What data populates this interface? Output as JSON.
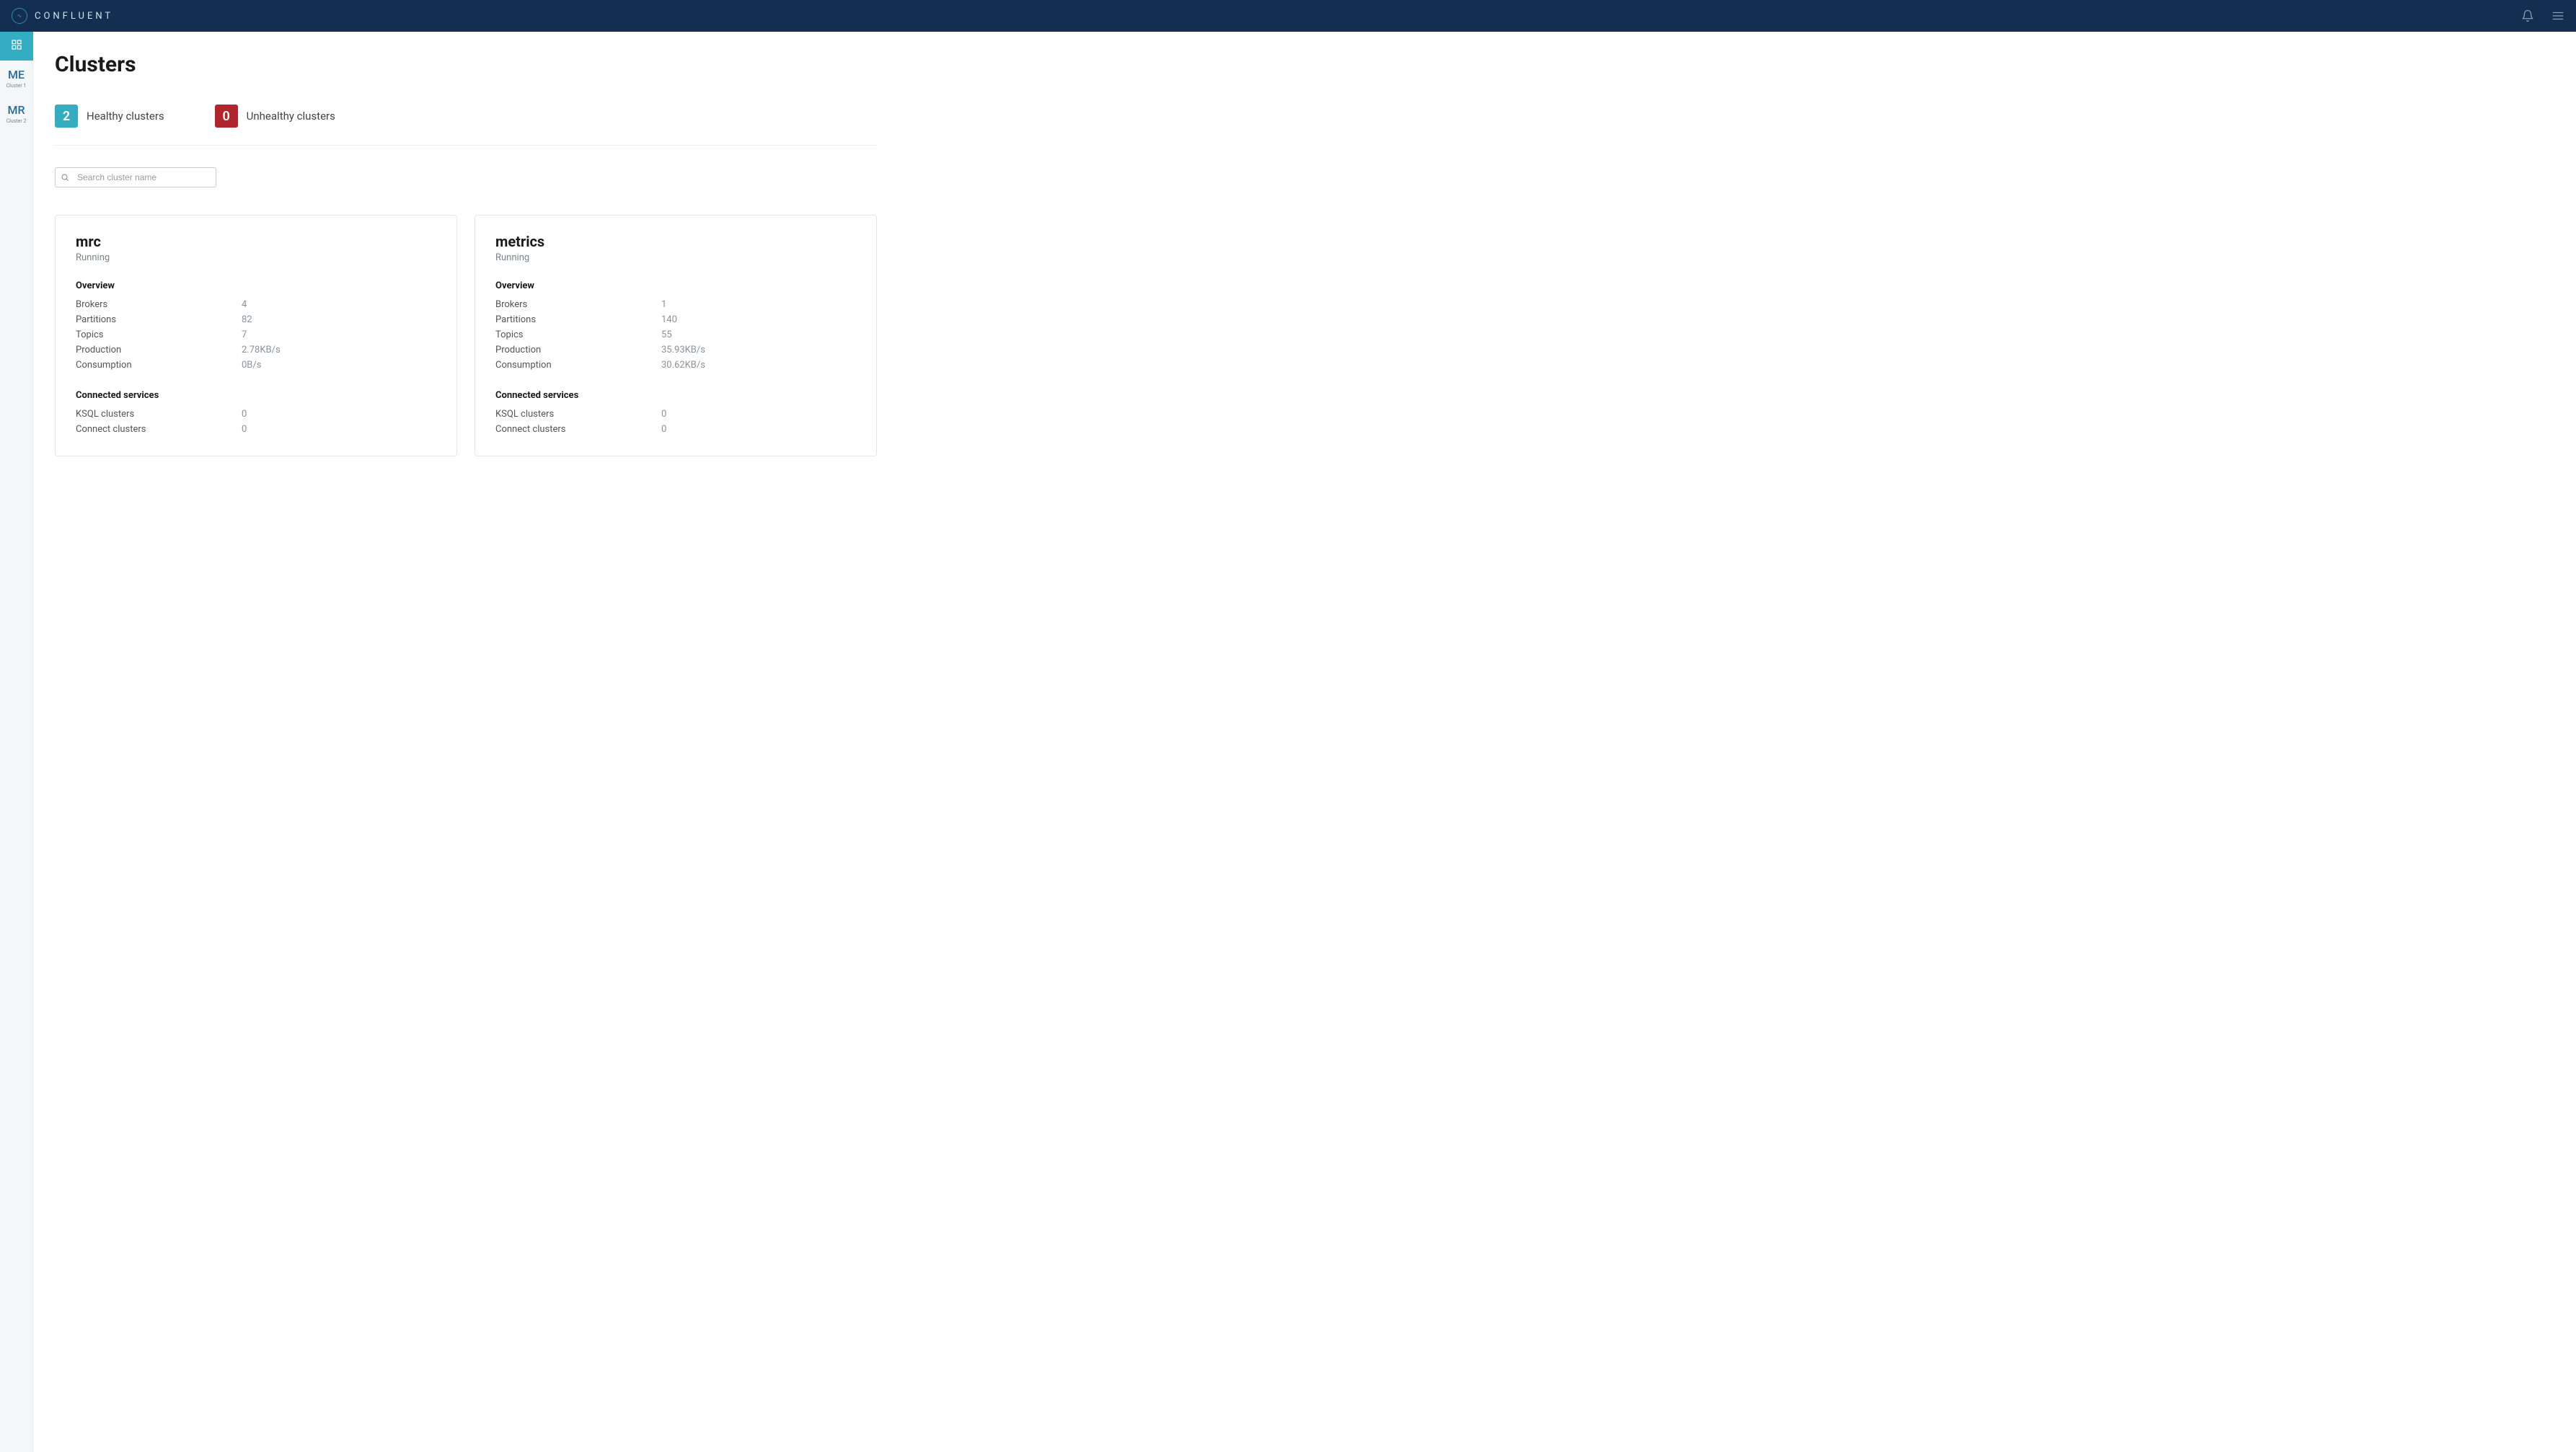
{
  "brand": "CONFLUENT",
  "sidebar": {
    "items": [
      {
        "abbr": "ME",
        "label": "Cluster 1"
      },
      {
        "abbr": "MR",
        "label": "Cluster 2"
      }
    ]
  },
  "page": {
    "title": "Clusters",
    "healthy": {
      "count": "2",
      "label": "Healthy clusters"
    },
    "unhealthy": {
      "count": "0",
      "label": "Unhealthy clusters"
    },
    "search_placeholder": "Search cluster name",
    "labels": {
      "overview": "Overview",
      "brokers": "Brokers",
      "partitions": "Partitions",
      "topics": "Topics",
      "production": "Production",
      "consumption": "Consumption",
      "connected": "Connected services",
      "ksql": "KSQL clusters",
      "connect": "Connect clusters"
    }
  },
  "clusters": [
    {
      "name": "mrc",
      "status": "Running",
      "overview": {
        "brokers": "4",
        "partitions": "82",
        "topics": "7",
        "production": "2.78KB/s",
        "consumption": "0B/s"
      },
      "connected": {
        "ksql": "0",
        "connect": "0"
      }
    },
    {
      "name": "metrics",
      "status": "Running",
      "overview": {
        "brokers": "1",
        "partitions": "140",
        "topics": "55",
        "production": "35.93KB/s",
        "consumption": "30.62KB/s"
      },
      "connected": {
        "ksql": "0",
        "connect": "0"
      }
    }
  ]
}
